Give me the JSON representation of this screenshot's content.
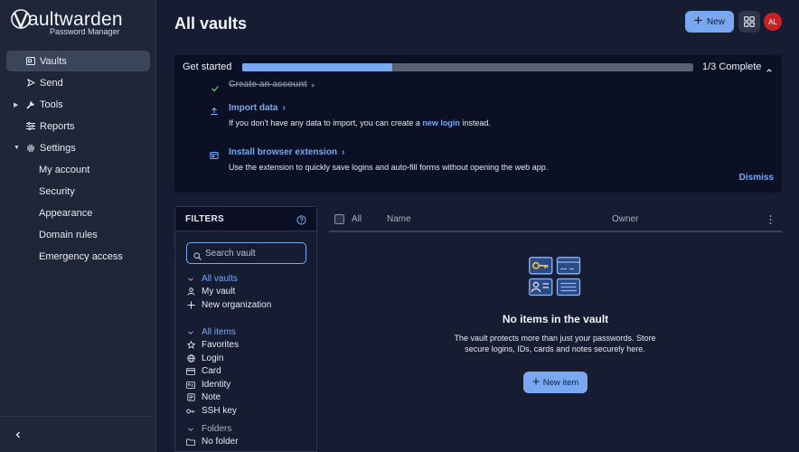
{
  "brand": {
    "name": "aultwarden",
    "subtitle": "Password Manager"
  },
  "sidebar": {
    "items": [
      {
        "label": "Vaults",
        "icon": "vault-icon",
        "active": true
      },
      {
        "label": "Send",
        "icon": "send-icon"
      },
      {
        "label": "Tools",
        "icon": "tools-icon",
        "expandable": true
      },
      {
        "label": "Reports",
        "icon": "reports-icon"
      },
      {
        "label": "Settings",
        "icon": "gear-icon",
        "expanded": true
      }
    ],
    "settings_children": [
      "My account",
      "Security",
      "Appearance",
      "Domain rules",
      "Emergency access"
    ]
  },
  "header": {
    "title": "All vaults",
    "new_label": "New",
    "avatar_initials": "AL"
  },
  "get_started": {
    "title": "Get started",
    "progress": 0.333,
    "complete_label": "1/3 Complete",
    "steps": {
      "create": {
        "title": "Create an account"
      },
      "import": {
        "title": "Import data",
        "desc_before": "If you don't have any data to import, you can create a ",
        "desc_link": "new login",
        "desc_after": " instead."
      },
      "extension": {
        "title": "Install browser extension",
        "desc": "Use the extension to quickly save logins and auto-fill forms without opening the web app."
      }
    },
    "dismiss_label": "Dismiss"
  },
  "filters": {
    "title": "FILTERS",
    "search_placeholder": "Search vault",
    "vaults": {
      "heading": "All vaults",
      "items": [
        "My vault",
        "New organization"
      ]
    },
    "types": {
      "heading": "All items",
      "items": [
        "Favorites",
        "Login",
        "Card",
        "Identity",
        "Note",
        "SSH key"
      ]
    },
    "folders": {
      "heading": "Folders",
      "items": [
        "No folder"
      ]
    }
  },
  "table": {
    "col_all": "All",
    "col_name": "Name",
    "col_owner": "Owner"
  },
  "empty": {
    "title": "No items in the vault",
    "desc": "The vault protects more than just your passwords. Store secure logins, IDs, cards and notes securely here.",
    "button_label": "New item"
  },
  "colors": {
    "accent": "#79a8f0",
    "avatar": "#c82222",
    "panel": "#0b1024"
  }
}
